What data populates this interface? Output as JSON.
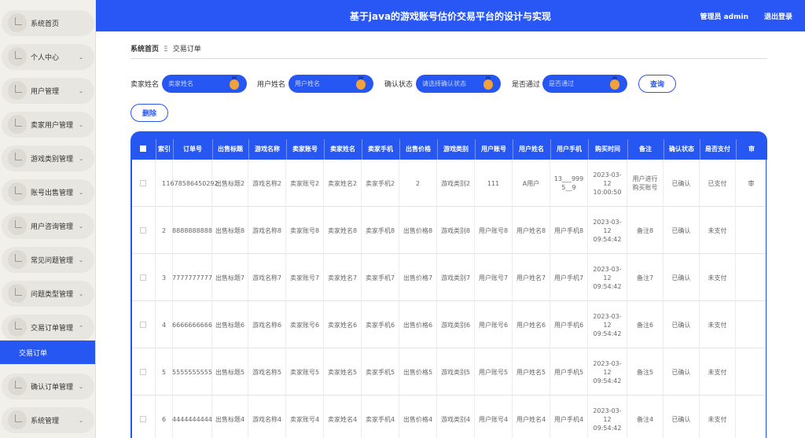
{
  "header": {
    "title": "基于java的游戏账号估价交易平台的设计与实现",
    "admin": "管理员 admin",
    "logout": "退出登录"
  },
  "sidebar": {
    "items": [
      {
        "label": "系统首页",
        "chevron": ""
      },
      {
        "label": "个人中心",
        "chevron": "⌄"
      },
      {
        "label": "用户管理",
        "chevron": "⌄"
      },
      {
        "label": "卖家用户管理",
        "chevron": "⌄"
      },
      {
        "label": "游戏类别管理",
        "chevron": "⌄"
      },
      {
        "label": "账号出售管理",
        "chevron": "⌄"
      },
      {
        "label": "用户咨询管理",
        "chevron": "⌄"
      },
      {
        "label": "常见问题管理",
        "chevron": "⌄"
      },
      {
        "label": "问题类型管理",
        "chevron": "⌄"
      },
      {
        "label": "交易订单管理",
        "chevron": "⌃"
      },
      {
        "label": "确认订单管理",
        "chevron": "⌄"
      },
      {
        "label": "系统管理",
        "chevron": "⌄"
      }
    ],
    "active_sub": "交易订单"
  },
  "breadcrumb": {
    "home": "系统首页",
    "sep": "Ξ",
    "current": "交易订单"
  },
  "filters": [
    {
      "label": "卖家姓名",
      "placeholder": "卖家姓名"
    },
    {
      "label": "用户姓名",
      "placeholder": "用户姓名"
    },
    {
      "label": "确认状态",
      "placeholder": "请选择确认状态"
    },
    {
      "label": "是否通过",
      "placeholder": "是否通过"
    }
  ],
  "buttons": {
    "search": "查询",
    "delete": "删除"
  },
  "table": {
    "headers": [
      "",
      "索引",
      "订单号",
      "出售标题",
      "游戏名称",
      "卖家账号",
      "卖家姓名",
      "卖家手机",
      "出售价格",
      "游戏类别",
      "用户账号",
      "用户姓名",
      "用户手机",
      "购买时间",
      "备注",
      "确认状态",
      "是否支付",
      "审"
    ],
    "rows": [
      [
        "",
        "1",
        "1678586450292",
        "出售标题2",
        "游戏名称2",
        "卖家账号2",
        "卖家姓名2",
        "卖家手机2",
        "2",
        "游戏类别2",
        "111",
        "A用户",
        "13___999 5__9",
        "2023-03-12 10:00:50",
        "用户进行购买账号",
        "已确认",
        "已支付",
        "审"
      ],
      [
        "",
        "2",
        "8888888888",
        "出售标题8",
        "游戏名称8",
        "卖家账号8",
        "卖家姓名8",
        "卖家手机8",
        "出售价格8",
        "游戏类别8",
        "用户账号8",
        "用户姓名8",
        "用户手机8",
        "2023-03-12 09:54:42",
        "备注8",
        "已确认",
        "未支付",
        ""
      ],
      [
        "",
        "3",
        "7777777777",
        "出售标题7",
        "游戏名称7",
        "卖家账号7",
        "卖家姓名7",
        "卖家手机7",
        "出售价格7",
        "游戏类别7",
        "用户账号7",
        "用户姓名7",
        "用户手机7",
        "2023-03-12 09:54:42",
        "备注7",
        "已确认",
        "未支付",
        ""
      ],
      [
        "",
        "4",
        "6666666666",
        "出售标题6",
        "游戏名称6",
        "卖家账号6",
        "卖家姓名6",
        "卖家手机6",
        "出售价格6",
        "游戏类别6",
        "用户账号6",
        "用户姓名6",
        "用户手机6",
        "2023-03-12 09:54:42",
        "备注6",
        "已确认",
        "未支付",
        ""
      ],
      [
        "",
        "5",
        "5555555555",
        "出售标题5",
        "游戏名称5",
        "卖家账号5",
        "卖家姓名5",
        "卖家手机5",
        "出售价格5",
        "游戏类别5",
        "用户账号5",
        "用户姓名5",
        "用户手机5",
        "2023-03-12 09:54:42",
        "备注5",
        "已确认",
        "未支付",
        ""
      ],
      [
        "",
        "6",
        "4444444444",
        "出售标题4",
        "游戏名称4",
        "卖家账号4",
        "卖家姓名4",
        "卖家手机4",
        "出售价格4",
        "游戏类别4",
        "用户账号4",
        "用户姓名4",
        "用户手机4",
        "2023-03-12 09:54:42",
        "备注4",
        "已确认",
        "未支付",
        ""
      ]
    ]
  },
  "colors": {
    "accent": "#2657f2",
    "knob": "#f2a23a"
  }
}
